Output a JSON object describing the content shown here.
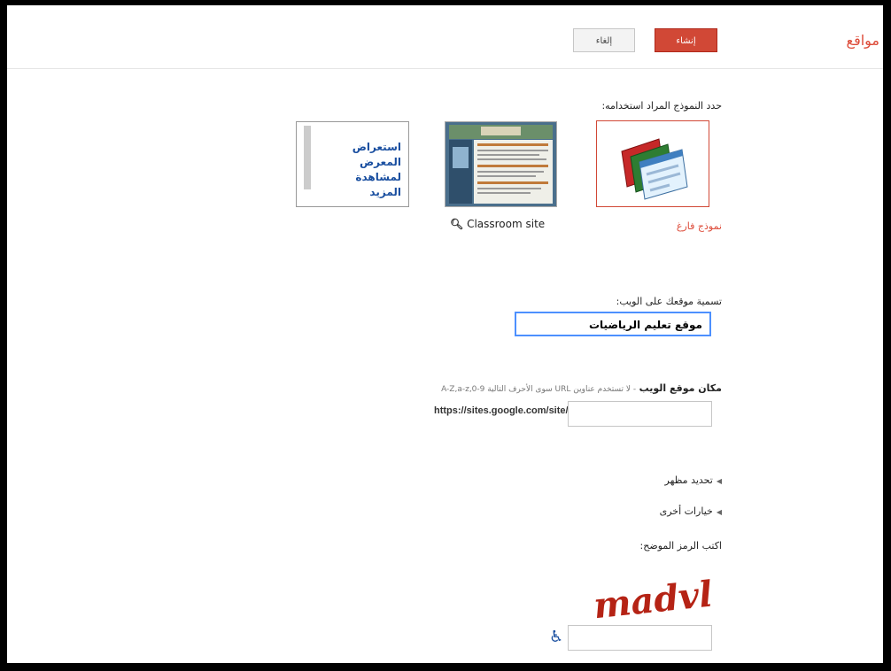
{
  "header": {
    "app_title": "مواقع",
    "create_label": "إنشاء",
    "cancel_label": "إلغاء"
  },
  "templates": {
    "prompt": "حدد النموذج المراد استخدامه:",
    "items": [
      {
        "label": "نموذج فارغ",
        "selected": true
      },
      {
        "label": "Classroom site",
        "icon": "magnify-icon"
      }
    ],
    "gallery_link": "استعراض المعرض لمشاهدة المزيد"
  },
  "site_name": {
    "label": "تسمية موقعك على الويب:",
    "value": "موقع تعليم الرياضيات"
  },
  "site_location": {
    "label_bold": "مكان موقع الويب",
    "label_note": "- لا تستخدم عناوين URL سوى الأحرف التالية A-Z,a-z,0-9",
    "prefix": "https://sites.google.com/site/",
    "value": ""
  },
  "options": {
    "theme": "تحديد مظهر",
    "more": "خيارات أخرى"
  },
  "captcha": {
    "label": "اكتب الرمز الموضح:",
    "image_text": "madvl",
    "value": "",
    "accessibility_icon": "wheelchair-icon"
  },
  "colors": {
    "accent": "#dd4b39",
    "create_button": "#d14836",
    "focus": "#4d90fe",
    "link": "#1a4fa0"
  }
}
